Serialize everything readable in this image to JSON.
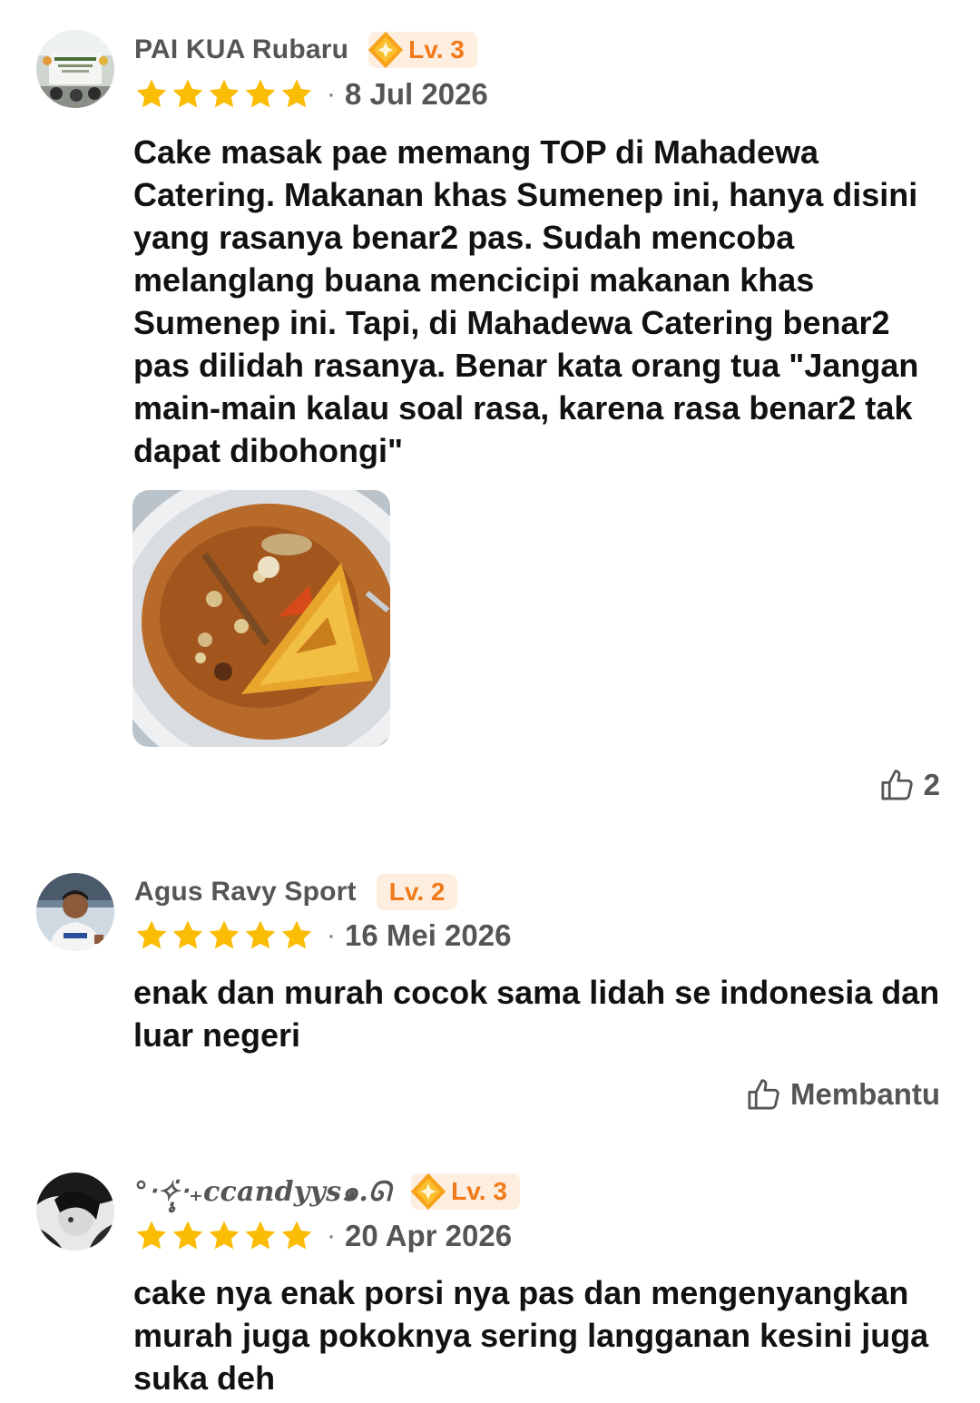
{
  "reviews": [
    {
      "user_name": "PAI KUA Rubaru",
      "level": "Lv. 3",
      "rating": 5,
      "separator": "·",
      "date": "8 Jul 2026",
      "text": "Cake masak pae memang TOP di Mahadewa Catering. Makanan khas Sumenep ini, hanya disini yang rasanya benar2 pas. Sudah mencoba melanglang buana mencicipi makanan khas Sumenep ini. Tapi, di Mahadewa Catering benar2 pas dilidah rasanya. Benar kata orang tua \"Jangan main-main kalau soal rasa, karena rasa benar2 tak dapat dibohongi\"",
      "helpful_label": "2"
    },
    {
      "user_name": "Agus Ravy Sport",
      "level": "Lv. 2",
      "rating": 5,
      "separator": "·",
      "date": "16 Mei 2026",
      "text": "enak dan murah cocok sama lidah se indonesia dan luar negeri",
      "helpful_label": "Membantu"
    },
    {
      "user_name": "°‧✧̣̥̇‧₊ccandyys๑.ᘏ",
      "level": "Lv. 3",
      "rating": 5,
      "separator": "·",
      "date": "20 Apr 2026",
      "text": "cake nya enak porsi nya pas dan mengenyangkan murah juga pokoknya sering langganan kesini juga suka deh"
    }
  ],
  "colors": {
    "star": "#fbbc04",
    "badge_bg": "#fdeee0",
    "badge_text": "#f07a1a",
    "diamond": "#f7a21b",
    "muted": "#555555",
    "body_text": "#111111"
  },
  "icons": {
    "star": "star-icon",
    "level_diamond": "diamond-badge-icon",
    "helpful": "thumbs-up-icon"
  }
}
